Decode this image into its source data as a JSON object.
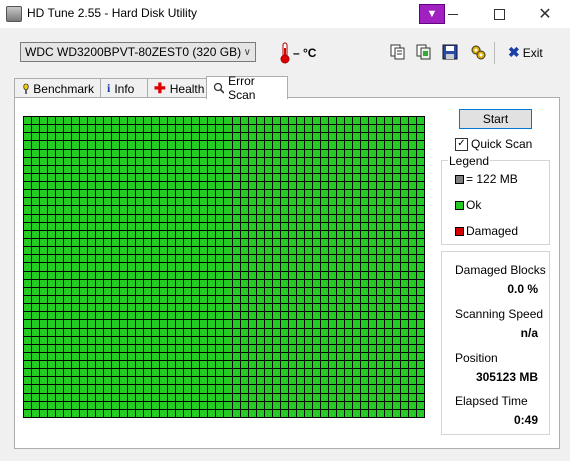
{
  "window": {
    "title": "HD Tune 2.55 - Hard Disk Utility"
  },
  "toolbar": {
    "drive": "WDC WD3200BPVT-80ZEST0 (320 GB)",
    "temperature": "– °C",
    "exit_label": "Exit"
  },
  "tabs": [
    {
      "label": "Benchmark",
      "icon": "benchmark-icon"
    },
    {
      "label": "Info",
      "icon": "info-icon"
    },
    {
      "label": "Health",
      "icon": "health-icon"
    },
    {
      "label": "Error Scan",
      "icon": "error-scan-icon",
      "active": true
    }
  ],
  "scan": {
    "start_label": "Start",
    "quick_scan_label": "Quick Scan",
    "quick_scan_checked": true,
    "grid_columns": 50,
    "grid_rows": 37
  },
  "legend": {
    "title": "Legend",
    "block_size": "= 122 MB",
    "ok": "Ok",
    "damaged": "Damaged"
  },
  "stats": {
    "damaged_blocks_label": "Damaged Blocks",
    "damaged_blocks_value": "0.0 %",
    "scanning_speed_label": "Scanning Speed",
    "scanning_speed_value": "n/a",
    "position_label": "Position",
    "position_value": "305123 MB",
    "elapsed_label": "Elapsed Time",
    "elapsed_value": "0:49"
  },
  "colors": {
    "ok": "#22cc22",
    "damaged": "#d40000",
    "block": "#808080",
    "accent": "#0078d7"
  }
}
